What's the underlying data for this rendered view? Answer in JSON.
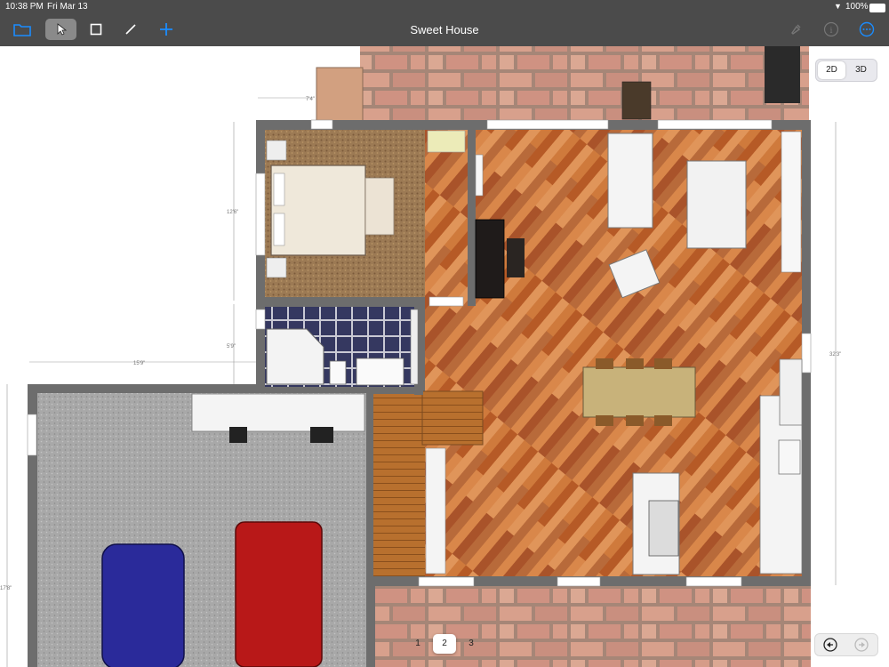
{
  "status_bar": {
    "time": "10:38 PM",
    "date": "Fri Mar 13",
    "battery": "100%"
  },
  "toolbar": {
    "title": "Sweet House",
    "icons": [
      "folder-icon",
      "select-arrow-icon",
      "rectangle-icon",
      "line-icon",
      "plus-icon",
      "pin-icon",
      "info-icon",
      "more-icon"
    ]
  },
  "view_toggle": {
    "options": [
      "2D",
      "3D"
    ],
    "selected": "2D"
  },
  "pages": {
    "items": [
      "1",
      "2",
      "3"
    ],
    "selected": "2"
  },
  "dimensions": {
    "top": "7'4\"",
    "bedroom_height": "12'6\"",
    "bath_height": "5'9\"",
    "garage_width": "15'9\"",
    "right_height": "32'3\"",
    "garage_height": "17'8\""
  },
  "colors": {
    "accent": "#1a8cff",
    "toolbar_bg": "#3c3c3c",
    "floor_wood": "#c46a2e",
    "brick": "#d49a86",
    "carpet": "#9c7a54",
    "garage_floor": "#a6a6a6",
    "tile": "#353860"
  }
}
